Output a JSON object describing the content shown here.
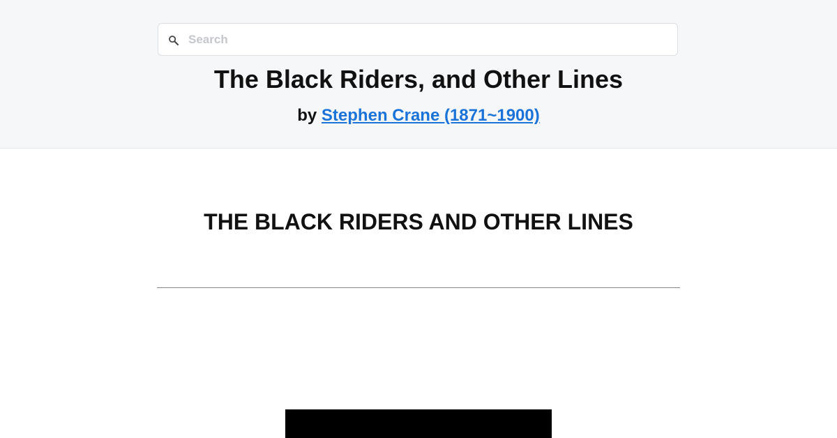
{
  "search": {
    "placeholder": "Search",
    "value": "",
    "icon": "search-icon"
  },
  "book": {
    "title": "The Black Riders, and Other Lines",
    "by_prefix": "by",
    "author_link": "Stephen Crane (1871~1900)"
  },
  "content": {
    "heading": "THE BLACK RIDERS AND OTHER LINES"
  },
  "colors": {
    "header_background": "#f6f7f9",
    "link": "#1a73d9",
    "text": "#111111"
  }
}
